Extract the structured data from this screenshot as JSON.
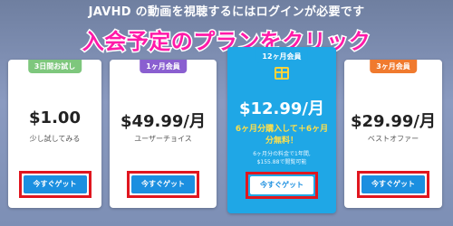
{
  "banner": {
    "text": "JAVHD の動画を視聴するにはログインが必要です"
  },
  "headline": {
    "text": "入会予定のプランをクリック"
  },
  "plans": [
    {
      "tag": "3日間お試し",
      "price": "$1.00",
      "sub": "少し試してみる",
      "button": "今すぐゲット",
      "tag_color": "#7ec77d"
    },
    {
      "tag": "1ヶ月会員",
      "price": "$49.99/月",
      "sub": "ユーザーチョイス",
      "button": "今すぐゲット",
      "tag_color": "#8a5fd0"
    },
    {
      "tag": "12ヶ月会員",
      "price": "$12.99/月",
      "promo_line1": "6ヶ月分購入して＋6ヶ月",
      "promo_line2": "分無料！",
      "fine_line1": "6ヶ月分の料金で1年間,",
      "fine_line2": "$155.88で閲覧可能",
      "button": "今すぐゲット",
      "icon": "gift-icon",
      "tag_color": "#1fa7e6"
    },
    {
      "tag": "3ヶ月会員",
      "price": "$29.99/月",
      "sub": "ベストオファー",
      "button": "今すぐゲット",
      "tag_color": "#f07a2e"
    }
  ],
  "colors": {
    "highlight_border": "#e0161f",
    "button_blue": "#1b8fe0",
    "headline_pink": "#ff1aa8"
  }
}
